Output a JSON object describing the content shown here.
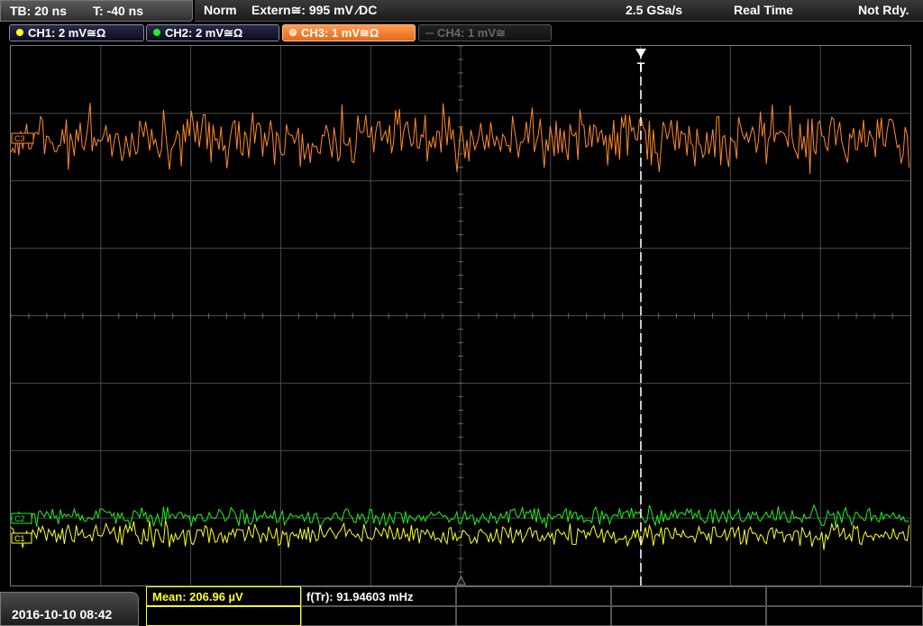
{
  "topbar": {
    "timebase": "TB: 20 ns",
    "trigger_offset": "T: -40 ns",
    "mode": "Norm",
    "trigger_source": "Extern≅: 995 mV ⁄DC",
    "sample_rate": "2.5 GSa/s",
    "acquisition": "Real Time",
    "status": "Not Rdy."
  },
  "channels": [
    {
      "label": "CH1: 2 mV≅Ω",
      "color": "#ffff22",
      "state": "on"
    },
    {
      "label": "CH2: 2 mV≅Ω",
      "color": "#22ee22",
      "state": "on"
    },
    {
      "label": "CH3: 1 mV≅Ω",
      "color": "#ff8a2a",
      "state": "active"
    },
    {
      "label": "CH4: 1 mV≅",
      "color": "#666666",
      "state": "off"
    }
  ],
  "markers": {
    "ch3": "C3",
    "ch2": "C2",
    "ch1": "C1",
    "trigger": "T"
  },
  "bottom": {
    "datetime": "2016-10-10 08:42",
    "mean": "Mean: 206.96 µV",
    "freq": "f(Tr): 91.94603 mHz"
  },
  "colors": {
    "ch1": "#ffff22",
    "ch2": "#22ee22",
    "ch3": "#ff8a2a",
    "grid": "#4a4a4a"
  }
}
